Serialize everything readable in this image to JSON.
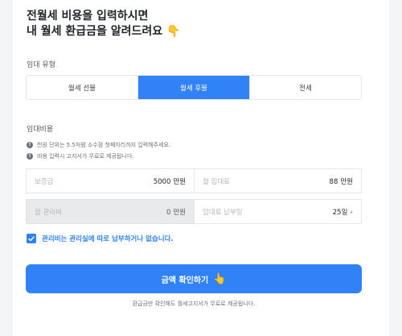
{
  "headline": {
    "line1": "전월세 비용을 입력하시면",
    "line2": "내 월세 환급금을 알려드려요",
    "emoji": "👇"
  },
  "rent_type": {
    "label": "임대 유형",
    "options": [
      "월세 선불",
      "월세 후불",
      "전세"
    ],
    "selected_index": 1
  },
  "rent_cost": {
    "label": "임대비용",
    "notes": [
      "천원 단위는 5.5처럼 소수점 첫째자리까지 입력해주세요.",
      "비용 입력시 고지서가 무료로 제공됩니다."
    ],
    "info_icon": "info-icon"
  },
  "fields": {
    "deposit": {
      "label": "보증금",
      "value": "5000",
      "unit": "만원"
    },
    "monthly_rent": {
      "label": "월 임대료",
      "value": "88",
      "unit": "만원"
    },
    "maintenance_fee": {
      "label": "월 관리비",
      "value": "0",
      "unit": "만원"
    },
    "payment_day": {
      "label": "임대료 납부일",
      "value": "25일",
      "icon": "chevron-right-icon"
    }
  },
  "maintenance_checkbox": {
    "checked": true,
    "label": "관리비는 관리실에 따로 납부하거나 없습니다."
  },
  "cta": {
    "label": "금액 확인하기",
    "icon": "pointing-hand-icon",
    "emoji": "👆"
  },
  "footnote": "환급금만 확인해도 월세고지서가 무료로 제공됩니다.",
  "colors": {
    "accent": "#3182f6",
    "disabled_bg": "#e9eaec",
    "border": "#e4e6ea",
    "text_primary": "#1f2329"
  }
}
